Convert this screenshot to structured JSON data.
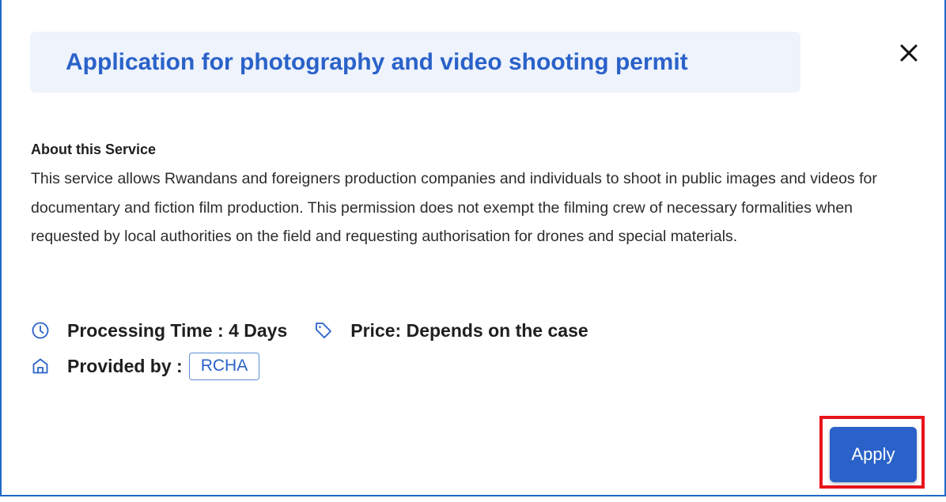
{
  "modal": {
    "title": "Application for photography and video shooting permit",
    "close_icon": "close-icon"
  },
  "about": {
    "heading": "About this Service",
    "description": "This service allows Rwandans and foreigners production companies and individuals to shoot in public images and videos for documentary and fiction film production. This permission does not exempt the filming crew of necessary formalities when requested by local authorities on the field and requesting authorisation for drones and special materials."
  },
  "details": {
    "processing_time": "Processing Time : 4 Days",
    "price": "Price: Depends on the case",
    "provided_by_label": "Provided by :",
    "provider": "RCHA",
    "icons": [
      "clock-icon",
      "tag-icon",
      "building-icon"
    ]
  },
  "actions": {
    "apply_label": "Apply"
  },
  "colors": {
    "accent": "#2a62c9",
    "title_background": "#eef3fc",
    "highlight": "#e8141b",
    "border": "#1f6ac9"
  }
}
